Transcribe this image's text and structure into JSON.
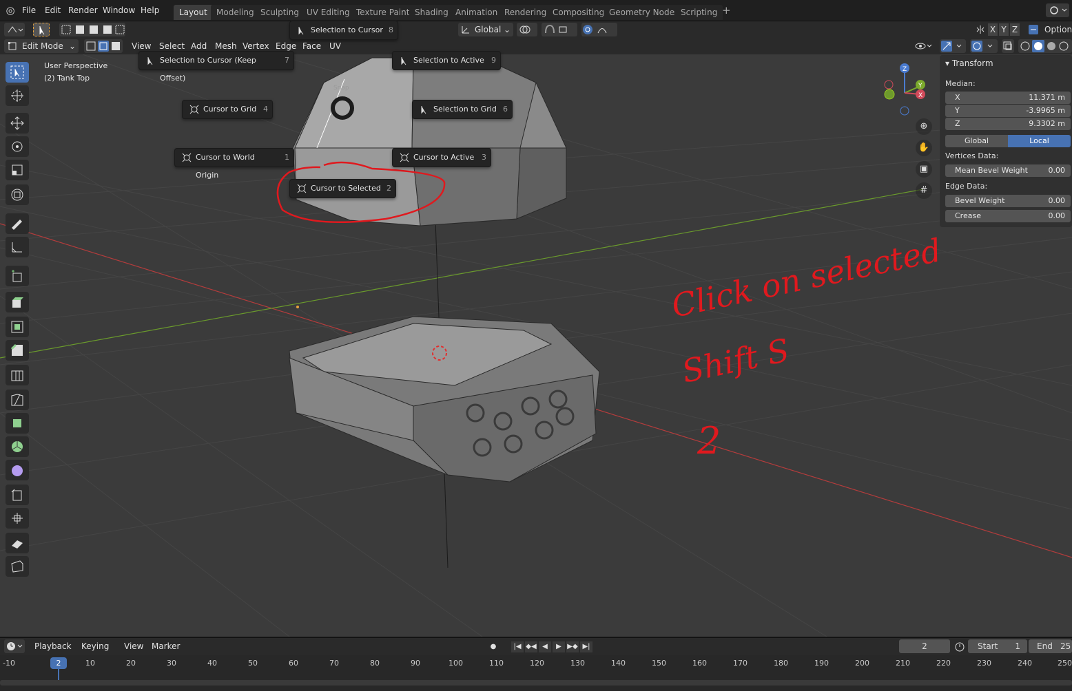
{
  "app": {
    "menus": [
      "File",
      "Edit",
      "Render",
      "Window",
      "Help"
    ],
    "workspaces": [
      "Layout",
      "Modeling",
      "Sculpting",
      "UV Editing",
      "Texture Paint",
      "Shading",
      "Animation",
      "Rendering",
      "Compositing",
      "Geometry Nodes",
      "Scripting"
    ],
    "active_workspace": "Layout",
    "add_tab": "+"
  },
  "header": {
    "transform_orientation": "Global",
    "axes": [
      "X",
      "Y",
      "Z"
    ],
    "options": "Options"
  },
  "editor_header": {
    "mode": "Edit Mode",
    "menus": [
      "View",
      "Select",
      "Add",
      "Mesh",
      "Vertex",
      "Edge",
      "Face",
      "UV"
    ]
  },
  "viewport": {
    "perspective": "User Perspective",
    "object": "(2) Tank Top",
    "pie_title": "Snap"
  },
  "pie_menu": {
    "selection_to_cursor": {
      "label": "Selection to Cursor",
      "key": "8"
    },
    "selection_to_cursor_offset": {
      "label": "Selection to Cursor (Keep Offset)",
      "key": "7"
    },
    "selection_to_active": {
      "label": "Selection to Active",
      "key": "9"
    },
    "cursor_to_grid": {
      "label": "Cursor to Grid",
      "key": "4"
    },
    "selection_to_grid": {
      "label": "Selection to Grid",
      "key": "6"
    },
    "cursor_to_world_origin": {
      "label": "Cursor to World Origin",
      "key": "1"
    },
    "cursor_to_active": {
      "label": "Cursor to Active",
      "key": "3"
    },
    "cursor_to_selected": {
      "label": "Cursor to Selected",
      "key": "2"
    }
  },
  "gizmo": {
    "x": "X",
    "y": "Y",
    "z": "Z"
  },
  "npanel": {
    "title": "Transform",
    "median_label": "Median:",
    "x": {
      "key": "X",
      "value": "11.371 m"
    },
    "y": {
      "key": "Y",
      "value": "-3.9965 m"
    },
    "z": {
      "key": "Z",
      "value": "9.3302 m"
    },
    "global": "Global",
    "local": "Local",
    "vertices_data": "Vertices Data:",
    "mean_bevel": {
      "key": "Mean Bevel Weight",
      "value": "0.00"
    },
    "edge_data": "Edge Data:",
    "bevel_weight": {
      "key": "Bevel Weight",
      "value": "0.00"
    },
    "crease": {
      "key": "Crease",
      "value": "0.00"
    }
  },
  "annotation": {
    "line1": "Click on selected",
    "line2": "Shift S",
    "line3": "2",
    "color": "#e0191e"
  },
  "timeline": {
    "menus": [
      "Playback",
      "Keying",
      "View",
      "Marker"
    ],
    "current_frame": "2",
    "start_label": "Start",
    "start_value": "1",
    "end_label": "End",
    "end_value": "25",
    "ticks": [
      "-10",
      "10",
      "20",
      "30",
      "40",
      "50",
      "60",
      "70",
      "80",
      "90",
      "100",
      "110",
      "120",
      "130",
      "140",
      "150",
      "160",
      "170",
      "180",
      "190",
      "200",
      "210",
      "220",
      "230",
      "240",
      "250"
    ]
  }
}
